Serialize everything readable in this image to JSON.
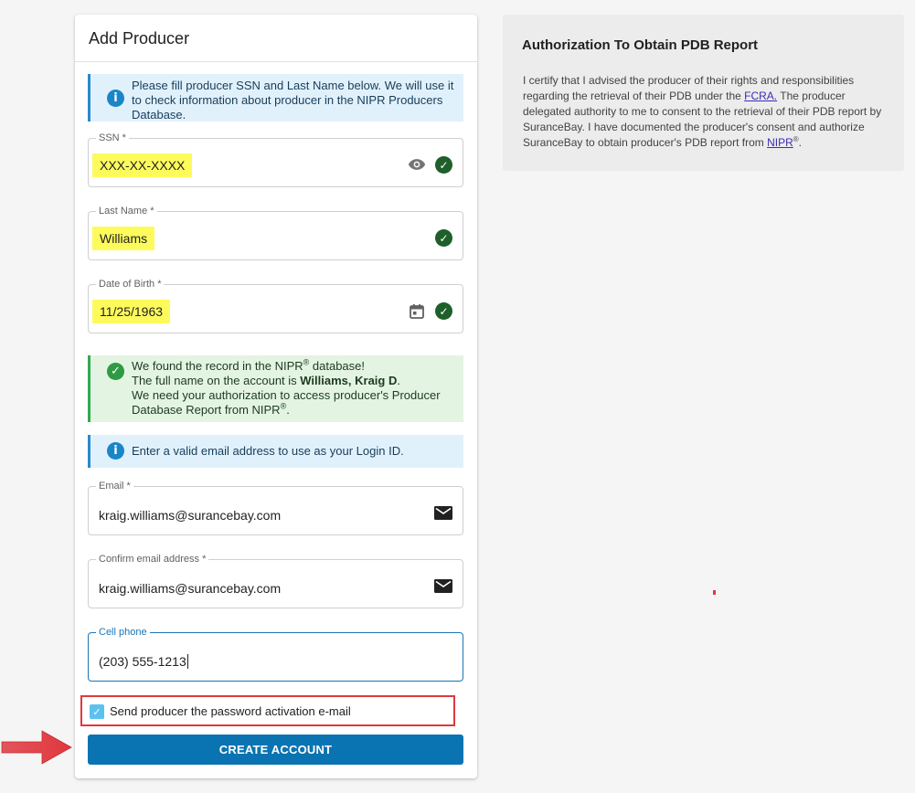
{
  "form": {
    "title": "Add Producer",
    "info_ssn": "Please fill producer SSN and Last Name below. We will use it to check information about producer in the NIPR Producers Database.",
    "ssn": {
      "label": "SSN *",
      "value": "XXX-XX-XXXX"
    },
    "last_name": {
      "label": "Last Name *",
      "value": "Williams"
    },
    "dob": {
      "label": "Date of Birth *",
      "value": "11/25/1963"
    },
    "found": {
      "line1_a": "We found the record in the NIPR",
      "reg": "®",
      "line1_b": " database!",
      "line2_a": "The full name on the account is ",
      "full_name": "Williams, Kraig D",
      "line2_b": ".",
      "line3_a": "We need your authorization to access producer's Producer Database Report from NIPR",
      "line3_b": "."
    },
    "info_email": "Enter a valid email address to use as your Login ID.",
    "email": {
      "label": "Email *",
      "value": "kraig.williams@surancebay.com"
    },
    "confirm_email": {
      "label": "Confirm email address *",
      "value": "kraig.williams@surancebay.com"
    },
    "cell_phone": {
      "label": "Cell phone",
      "value": "(203) 555-1213"
    },
    "send_email": {
      "label": "Send producer the password activation e-mail",
      "checked": true
    },
    "create_button": "CREATE ACCOUNT"
  },
  "authorization": {
    "title": "Authorization To Obtain PDB Report",
    "text_a": "I certify that I advised the producer of their rights and responsibilities regarding the retrieval of their PDB under the ",
    "fcra_link": "FCRA.",
    "text_b": " The producer delegated authority to me to consent to the retrieval of their PDB report by SuranceBay. I have documented the producer's consent and authorize SuranceBay to obtain producer's PDB report from ",
    "nipr_link": "NIPR",
    "reg": "®",
    "text_c": "."
  },
  "colors": {
    "primary_button": "#0a73b2",
    "highlight": "#fdfb5c",
    "annotation_red": "#e0383e",
    "info_bg": "#e1f1fc",
    "success_bg": "#e4f4e3"
  }
}
